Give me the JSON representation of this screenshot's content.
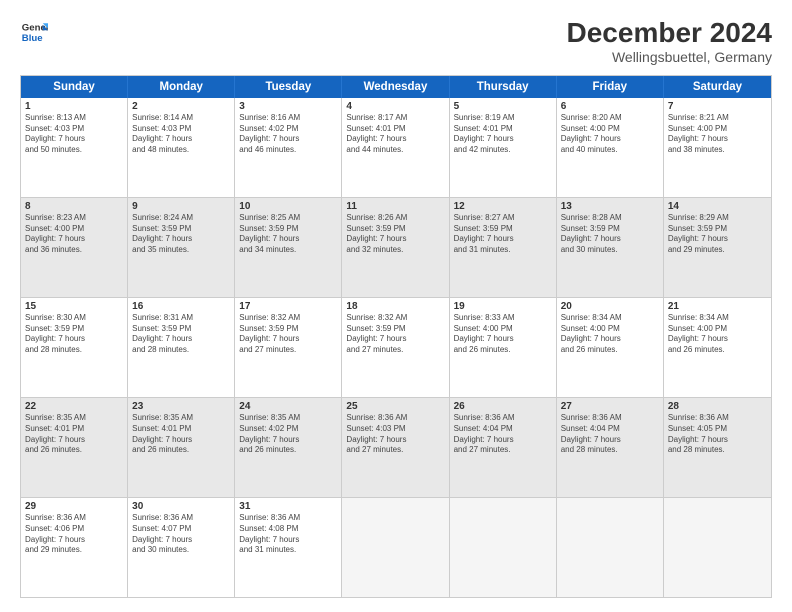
{
  "header": {
    "logo_line1": "General",
    "logo_line2": "Blue",
    "main_title": "December 2024",
    "subtitle": "Wellingsbuettel, Germany"
  },
  "calendar": {
    "weekdays": [
      "Sunday",
      "Monday",
      "Tuesday",
      "Wednesday",
      "Thursday",
      "Friday",
      "Saturday"
    ],
    "rows": [
      [
        {
          "day": "1",
          "info": "Sunrise: 8:13 AM\nSunset: 4:03 PM\nDaylight: 7 hours\nand 50 minutes.",
          "shade": false
        },
        {
          "day": "2",
          "info": "Sunrise: 8:14 AM\nSunset: 4:03 PM\nDaylight: 7 hours\nand 48 minutes.",
          "shade": false
        },
        {
          "day": "3",
          "info": "Sunrise: 8:16 AM\nSunset: 4:02 PM\nDaylight: 7 hours\nand 46 minutes.",
          "shade": false
        },
        {
          "day": "4",
          "info": "Sunrise: 8:17 AM\nSunset: 4:01 PM\nDaylight: 7 hours\nand 44 minutes.",
          "shade": false
        },
        {
          "day": "5",
          "info": "Sunrise: 8:19 AM\nSunset: 4:01 PM\nDaylight: 7 hours\nand 42 minutes.",
          "shade": false
        },
        {
          "day": "6",
          "info": "Sunrise: 8:20 AM\nSunset: 4:00 PM\nDaylight: 7 hours\nand 40 minutes.",
          "shade": false
        },
        {
          "day": "7",
          "info": "Sunrise: 8:21 AM\nSunset: 4:00 PM\nDaylight: 7 hours\nand 38 minutes.",
          "shade": false
        }
      ],
      [
        {
          "day": "8",
          "info": "Sunrise: 8:23 AM\nSunset: 4:00 PM\nDaylight: 7 hours\nand 36 minutes.",
          "shade": true
        },
        {
          "day": "9",
          "info": "Sunrise: 8:24 AM\nSunset: 3:59 PM\nDaylight: 7 hours\nand 35 minutes.",
          "shade": true
        },
        {
          "day": "10",
          "info": "Sunrise: 8:25 AM\nSunset: 3:59 PM\nDaylight: 7 hours\nand 34 minutes.",
          "shade": true
        },
        {
          "day": "11",
          "info": "Sunrise: 8:26 AM\nSunset: 3:59 PM\nDaylight: 7 hours\nand 32 minutes.",
          "shade": true
        },
        {
          "day": "12",
          "info": "Sunrise: 8:27 AM\nSunset: 3:59 PM\nDaylight: 7 hours\nand 31 minutes.",
          "shade": true
        },
        {
          "day": "13",
          "info": "Sunrise: 8:28 AM\nSunset: 3:59 PM\nDaylight: 7 hours\nand 30 minutes.",
          "shade": true
        },
        {
          "day": "14",
          "info": "Sunrise: 8:29 AM\nSunset: 3:59 PM\nDaylight: 7 hours\nand 29 minutes.",
          "shade": true
        }
      ],
      [
        {
          "day": "15",
          "info": "Sunrise: 8:30 AM\nSunset: 3:59 PM\nDaylight: 7 hours\nand 28 minutes.",
          "shade": false
        },
        {
          "day": "16",
          "info": "Sunrise: 8:31 AM\nSunset: 3:59 PM\nDaylight: 7 hours\nand 28 minutes.",
          "shade": false
        },
        {
          "day": "17",
          "info": "Sunrise: 8:32 AM\nSunset: 3:59 PM\nDaylight: 7 hours\nand 27 minutes.",
          "shade": false
        },
        {
          "day": "18",
          "info": "Sunrise: 8:32 AM\nSunset: 3:59 PM\nDaylight: 7 hours\nand 27 minutes.",
          "shade": false
        },
        {
          "day": "19",
          "info": "Sunrise: 8:33 AM\nSunset: 4:00 PM\nDaylight: 7 hours\nand 26 minutes.",
          "shade": false
        },
        {
          "day": "20",
          "info": "Sunrise: 8:34 AM\nSunset: 4:00 PM\nDaylight: 7 hours\nand 26 minutes.",
          "shade": false
        },
        {
          "day": "21",
          "info": "Sunrise: 8:34 AM\nSunset: 4:00 PM\nDaylight: 7 hours\nand 26 minutes.",
          "shade": false
        }
      ],
      [
        {
          "day": "22",
          "info": "Sunrise: 8:35 AM\nSunset: 4:01 PM\nDaylight: 7 hours\nand 26 minutes.",
          "shade": true
        },
        {
          "day": "23",
          "info": "Sunrise: 8:35 AM\nSunset: 4:01 PM\nDaylight: 7 hours\nand 26 minutes.",
          "shade": true
        },
        {
          "day": "24",
          "info": "Sunrise: 8:35 AM\nSunset: 4:02 PM\nDaylight: 7 hours\nand 26 minutes.",
          "shade": true
        },
        {
          "day": "25",
          "info": "Sunrise: 8:36 AM\nSunset: 4:03 PM\nDaylight: 7 hours\nand 27 minutes.",
          "shade": true
        },
        {
          "day": "26",
          "info": "Sunrise: 8:36 AM\nSunset: 4:04 PM\nDaylight: 7 hours\nand 27 minutes.",
          "shade": true
        },
        {
          "day": "27",
          "info": "Sunrise: 8:36 AM\nSunset: 4:04 PM\nDaylight: 7 hours\nand 28 minutes.",
          "shade": true
        },
        {
          "day": "28",
          "info": "Sunrise: 8:36 AM\nSunset: 4:05 PM\nDaylight: 7 hours\nand 28 minutes.",
          "shade": true
        }
      ],
      [
        {
          "day": "29",
          "info": "Sunrise: 8:36 AM\nSunset: 4:06 PM\nDaylight: 7 hours\nand 29 minutes.",
          "shade": false
        },
        {
          "day": "30",
          "info": "Sunrise: 8:36 AM\nSunset: 4:07 PM\nDaylight: 7 hours\nand 30 minutes.",
          "shade": false
        },
        {
          "day": "31",
          "info": "Sunrise: 8:36 AM\nSunset: 4:08 PM\nDaylight: 7 hours\nand 31 minutes.",
          "shade": false
        },
        {
          "day": "",
          "info": "",
          "shade": true,
          "empty": true
        },
        {
          "day": "",
          "info": "",
          "shade": true,
          "empty": true
        },
        {
          "day": "",
          "info": "",
          "shade": true,
          "empty": true
        },
        {
          "day": "",
          "info": "",
          "shade": true,
          "empty": true
        }
      ]
    ]
  }
}
